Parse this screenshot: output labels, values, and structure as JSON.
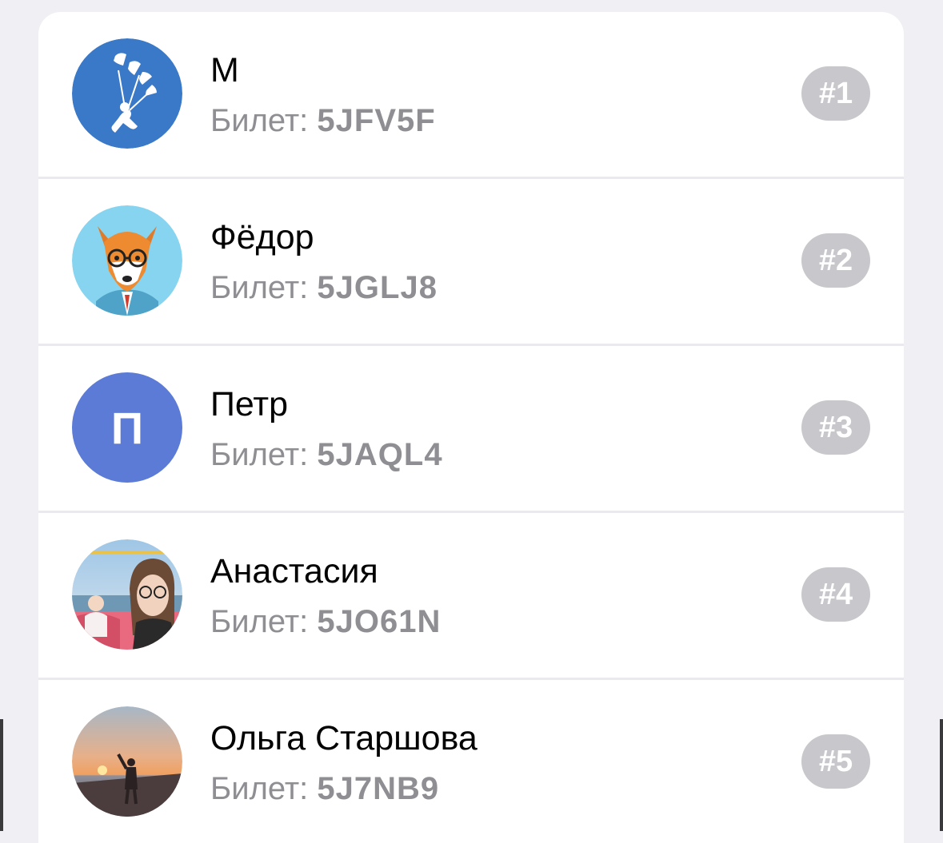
{
  "ticket_label": "Билет:",
  "participants": [
    {
      "name": "М",
      "ticket": "5JFV5F",
      "rank": "#1",
      "avatar_icon": "skydiver-icon",
      "avatar_color": "#3a78c8"
    },
    {
      "name": "Фёдор",
      "ticket": "5JGLJ8",
      "rank": "#2",
      "avatar_icon": "fox-icon",
      "avatar_color": "#86d4ef"
    },
    {
      "name": "Петр",
      "ticket": "5JAQL4",
      "rank": "#3",
      "avatar_letter": "П",
      "avatar_color": "#5b7bd6"
    },
    {
      "name": "Анастасия",
      "ticket": "5JO61N",
      "rank": "#4",
      "avatar_icon": "photo-avatar",
      "avatar_color": "#e96a7e"
    },
    {
      "name": "Ольга Старшова",
      "ticket": "5J7NB9",
      "rank": "#5",
      "avatar_icon": "sunset-photo-avatar",
      "avatar_color": "#d58a5a"
    }
  ],
  "colors": {
    "background": "#efeff4",
    "card": "#ffffff",
    "badge": "#c7c7cc",
    "secondary_text": "#8e8e93"
  }
}
